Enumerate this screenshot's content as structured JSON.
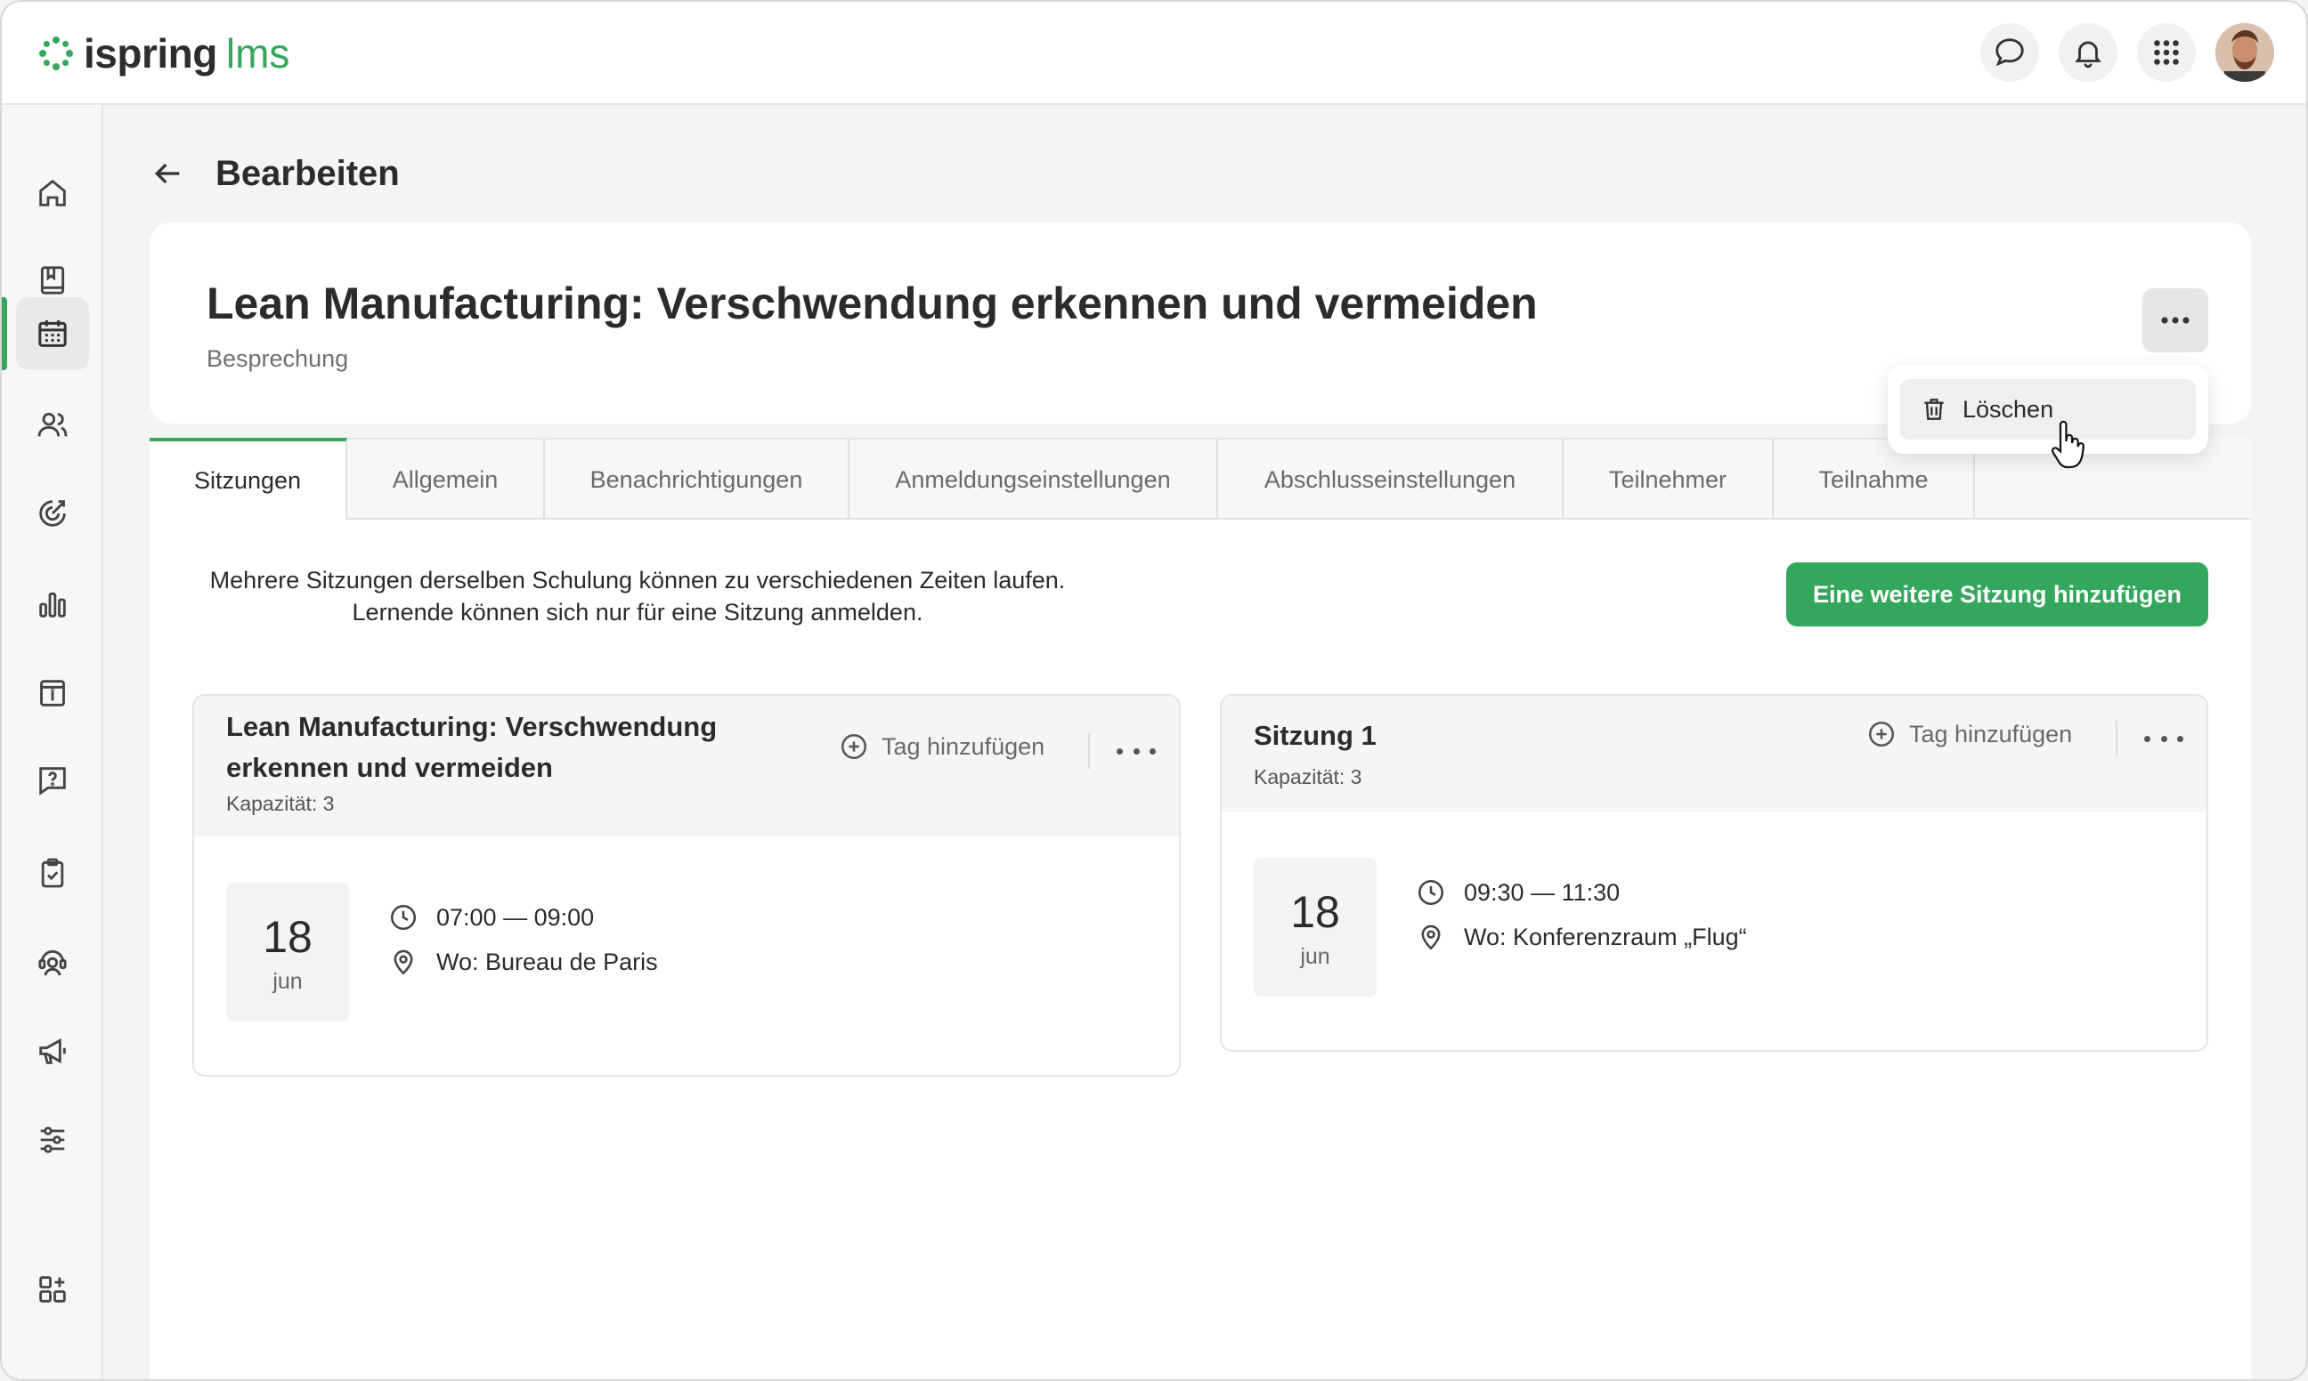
{
  "app": {
    "logo_word": "ispring",
    "logo_suffix": "lms"
  },
  "header": {
    "title": "Bearbeiten"
  },
  "course": {
    "title": "Lean Manufacturing: Verschwendung erkennen und vermeiden",
    "type": "Besprechung"
  },
  "menu": {
    "delete_label": "Löschen"
  },
  "tabs": [
    {
      "label": "Sitzungen"
    },
    {
      "label": "Allgemein"
    },
    {
      "label": "Benachrichtigungen"
    },
    {
      "label": "Anmeldungseinstellungen"
    },
    {
      "label": "Abschlusseinstellungen"
    },
    {
      "label": "Teilnehmer"
    },
    {
      "label": "Teilnahme"
    }
  ],
  "sessions_tab": {
    "intro_line1": "Mehrere Sitzungen derselben Schulung können zu verschiedenen Zeiten laufen.",
    "intro_line2": "Lernende können sich nur für eine Sitzung anmelden.",
    "add_button": "Eine weitere Sitzung hinzufügen"
  },
  "sessions": [
    {
      "title_line1": "Lean Manufacturing: Verschwendung",
      "title_line2": "erkennen und vermeiden",
      "capacity": "Kapazität: 3",
      "tag_add": "Tag hinzufügen",
      "day": "18",
      "month": "jun",
      "time": "07:00 — 09:00",
      "location": "Wo: Bureau de Paris"
    },
    {
      "title_line1": "Sitzung 1",
      "capacity": "Kapazität: 3",
      "tag_add": "Tag hinzufügen",
      "day": "18",
      "month": "jun",
      "time": "09:30 — 11:30",
      "location": "Wo: Konferenzraum „Flug“"
    }
  ],
  "colors": {
    "accent": "#34a75c",
    "text": "#2b2b2b",
    "muted": "#707070"
  }
}
